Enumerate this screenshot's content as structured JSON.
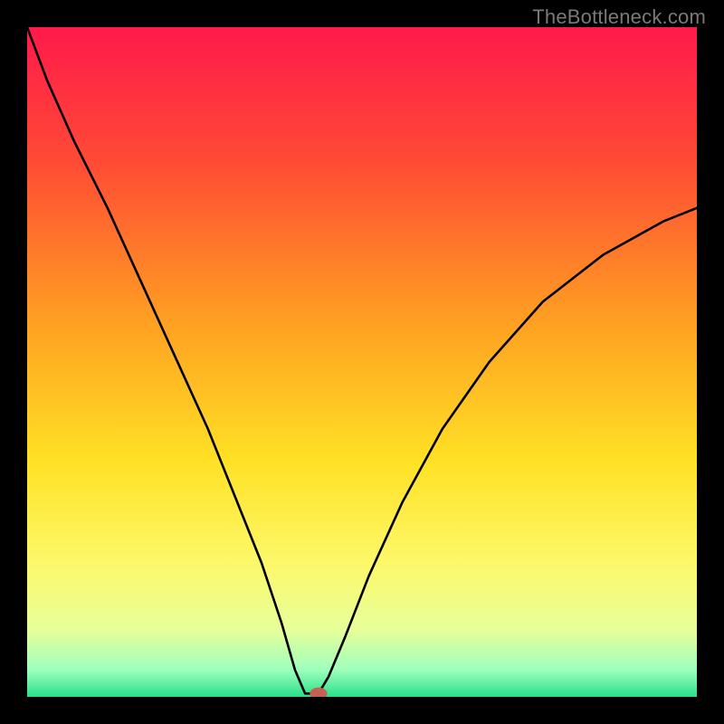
{
  "watermark": "TheBottleneck.com",
  "chart_data": {
    "type": "line",
    "title": "",
    "xlabel": "",
    "ylabel": "",
    "xlim": [
      0,
      100
    ],
    "ylim": [
      0,
      100
    ],
    "grid": false,
    "legend": false,
    "gradient_stops": [
      {
        "offset": 0,
        "color": "#ff1a4b"
      },
      {
        "offset": 20,
        "color": "#ff4a35"
      },
      {
        "offset": 45,
        "color": "#ffa321"
      },
      {
        "offset": 65,
        "color": "#ffe225"
      },
      {
        "offset": 80,
        "color": "#fdf86a"
      },
      {
        "offset": 90,
        "color": "#e7ff9a"
      },
      {
        "offset": 96,
        "color": "#9dffbc"
      },
      {
        "offset": 100,
        "color": "#27e08a"
      }
    ],
    "series": [
      {
        "name": "left-branch",
        "x": [
          0,
          3,
          7,
          12,
          17,
          22,
          27,
          31,
          35,
          38,
          40,
          41.5
        ],
        "y": [
          100,
          92,
          83,
          73,
          62,
          51,
          40,
          30,
          20,
          11,
          4,
          0.5
        ]
      },
      {
        "name": "flat-segment",
        "x": [
          41.5,
          43.5
        ],
        "y": [
          0.5,
          0.5
        ]
      },
      {
        "name": "right-branch",
        "x": [
          43.5,
          45.0,
          47.5,
          51,
          56,
          62,
          69,
          77,
          86,
          95,
          100
        ],
        "y": [
          0.5,
          3.0,
          9.0,
          18,
          29,
          40,
          50,
          59,
          66,
          71,
          73
        ]
      }
    ],
    "marker": {
      "x": 43.5,
      "y": 0.5,
      "rx": 1.3,
      "ry": 0.9,
      "color": "#c4624f"
    }
  }
}
